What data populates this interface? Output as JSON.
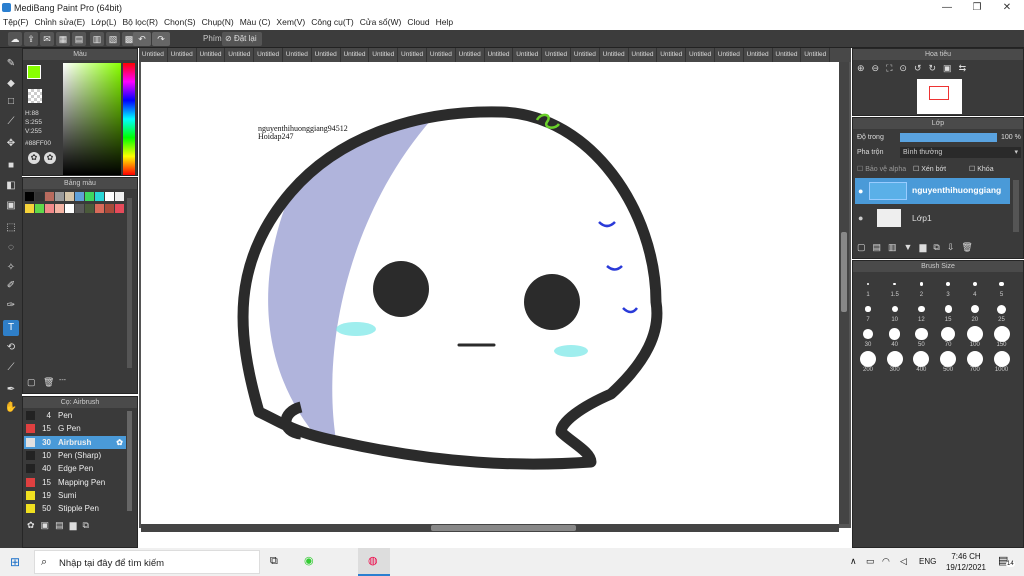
{
  "window": {
    "title": "MediBang Paint Pro (64bit)",
    "minimize": "—",
    "maximize": "❐",
    "close": "✕"
  },
  "menu": [
    "Tệp(F)",
    "Chỉnh sửa(E)",
    "Lớp(L)",
    "Bộ lọc(R)",
    "Chọn(S)",
    "Chụp(N)",
    "Màu (C)",
    "Xem(V)",
    "Công cụ(T)",
    "Cửa sổ(W)",
    "Cloud",
    "Help"
  ],
  "toolbar": {
    "shortcut_label": "Phím",
    "reset_label": "Đặt lại"
  },
  "tabs": [
    "Untitled",
    "Untitled",
    "Untitled",
    "Untitled",
    "Untitled",
    "Untitled",
    "Untitled",
    "Untitled",
    "Untitled",
    "Untitled",
    "Untitled",
    "Untitled",
    "Untitled",
    "Untitled",
    "Untitled",
    "Untitled",
    "Untitled",
    "Untitled",
    "Untitled",
    "Untitled",
    "Untitled",
    "Untitled",
    "Untitled",
    "Untitled"
  ],
  "color_panel": {
    "title": "Màu",
    "h": "H:88",
    "s": "S:255",
    "v": "V:255",
    "hex": "#88FF00",
    "fg_color": "#88ff00",
    "bg_color": "#000000"
  },
  "palette_panel": {
    "title": "Bảng màu",
    "swatches": [
      "#000000",
      "#333333",
      "#b86b5e",
      "#9a9a9a",
      "#d4c4a8",
      "#5fa0d8",
      "#3fd85f",
      "#2ad8d8",
      "#ffffff",
      "#f0f0f0",
      "#f6d33a",
      "#5fd84a",
      "#f28a8a",
      "#f4b4a4",
      "#ffffff",
      "#5a5a5a",
      "#4a5a3a",
      "#d86a5a",
      "#a84a3a",
      "#e64a5a"
    ],
    "add_label": "---"
  },
  "brush_panel": {
    "title": "Cọ: Airbrush",
    "brushes": [
      {
        "size": "4",
        "name": "Pen",
        "color": "#222222",
        "active": false
      },
      {
        "size": "15",
        "name": "G Pen",
        "color": "#e04040",
        "active": false
      },
      {
        "size": "30",
        "name": "Airbrush",
        "color": "#e0e0e0",
        "active": true
      },
      {
        "size": "10",
        "name": "Pen (Sharp)",
        "color": "#222222",
        "active": false
      },
      {
        "size": "40",
        "name": "Edge Pen",
        "color": "#222222",
        "active": false
      },
      {
        "size": "15",
        "name": "Mapping Pen",
        "color": "#e04040",
        "active": false
      },
      {
        "size": "19",
        "name": "Sumi",
        "color": "#f0e020",
        "active": false
      },
      {
        "size": "50",
        "name": "Stipple Pen",
        "color": "#f0e020",
        "active": false
      }
    ]
  },
  "navigator": {
    "title": "Hoa tiêu"
  },
  "layer_panel": {
    "title": "Lớp",
    "opacity_label": "Độ trong",
    "opacity_value": "100 %",
    "opacity_fraction": 1.0,
    "blend_label": "Pha trộn",
    "blend_value": "Bình thường",
    "protect_alpha": "Bảo vệ alpha",
    "clipping": "Xén bớt",
    "lock": "Khóa",
    "layers": [
      {
        "name": "nguyenthihuonggiang",
        "selected": true
      },
      {
        "name": "Lớp1",
        "selected": false
      }
    ]
  },
  "brush_size_panel": {
    "title": "Brush Size",
    "sizes": [
      "1",
      "1.5",
      "2",
      "3",
      "4",
      "5",
      "7",
      "10",
      "12",
      "15",
      "20",
      "25",
      "30",
      "40",
      "50",
      "70",
      "100",
      "150",
      "200",
      "300",
      "400",
      "500",
      "700",
      "1000"
    ]
  },
  "canvas": {
    "watermark_line1": "nguyenthihuonggiang94512",
    "watermark_line2": "Hoidap247"
  },
  "taskbar": {
    "search_placeholder": "Nhập tại đây để tìm kiếm",
    "lang": "ENG",
    "time": "7:46 CH",
    "date": "19/12/2021",
    "notif_count": "14"
  }
}
